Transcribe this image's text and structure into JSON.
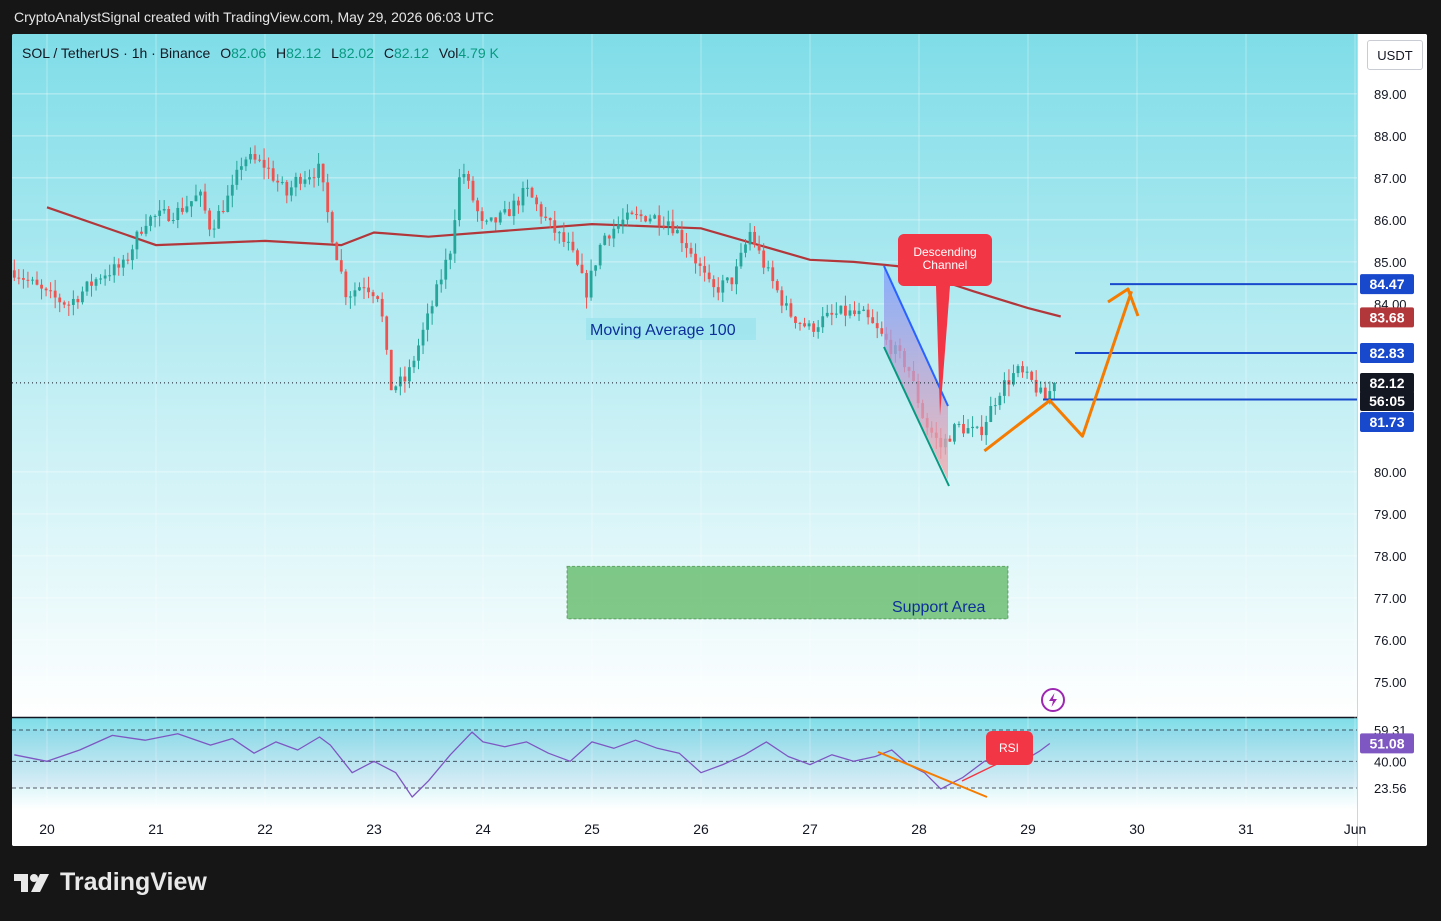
{
  "header": {
    "caption": "CryptoAnalystSignal created with TradingView.com, May 29, 2026 06:03 UTC"
  },
  "legend": {
    "symbol": "SOL / TetherUS · 1h · Binance",
    "open_label": "O",
    "open": "82.06",
    "high_label": "H",
    "high": "82.12",
    "low_label": "L",
    "low": "82.02",
    "close_label": "C",
    "close": "82.12",
    "vol_label": "Vol",
    "vol": "4.79 K"
  },
  "currency_button": "USDT",
  "brand": {
    "name": "TradingView",
    "logo_icon": "tradingview-logo-icon"
  },
  "colors": {
    "up": "#26a69a",
    "down": "#ef5350",
    "ma": "#b2373b",
    "channel": "#2962ff",
    "channel_lower": "#089981",
    "projection": "#f57c00",
    "support": "#4caf50",
    "callout": "#f23645",
    "rsi": "#7e57c2",
    "levels": "#1848cc"
  },
  "chart_data": [
    {
      "type": "candlestick",
      "title": "",
      "x_ticks": [
        "20",
        "21",
        "22",
        "23",
        "24",
        "25",
        "26",
        "27",
        "28",
        "29",
        "30",
        "31",
        "Jun"
      ],
      "y_ticks": [
        "75.00",
        "76.00",
        "77.00",
        "78.00",
        "79.00",
        "80.00",
        "84.00",
        "85.00",
        "86.00",
        "87.00",
        "88.00",
        "89.00"
      ],
      "ylim": [
        74.2,
        90.0
      ],
      "price_badges": [
        "84.47",
        "83.68",
        "82.83",
        "82.12",
        "56:05",
        "81.73"
      ],
      "current_price": 82.12,
      "moving_average_label": "Moving Average 100",
      "moving_average_100": [
        [
          0,
          86.3
        ],
        [
          1,
          85.4
        ],
        [
          2,
          85.5
        ],
        [
          2.7,
          85.4
        ],
        [
          3,
          85.7
        ],
        [
          3.5,
          85.6
        ],
        [
          4,
          85.7
        ],
        [
          5,
          85.9
        ],
        [
          6,
          85.8
        ],
        [
          7,
          85.05
        ],
        [
          7.4,
          85.0
        ],
        [
          7.8,
          84.9
        ],
        [
          8.5,
          84.3
        ],
        [
          9,
          83.9
        ],
        [
          9.3,
          83.7
        ]
      ],
      "close_path": [
        [
          -0.3,
          84.8
        ],
        [
          0,
          84.2
        ],
        [
          0.2,
          84.0
        ],
        [
          0.5,
          84.7
        ],
        [
          0.7,
          84.9
        ],
        [
          0.9,
          86.0
        ],
        [
          1.2,
          86.2
        ],
        [
          1.4,
          86.6
        ],
        [
          1.5,
          85.8
        ],
        [
          1.7,
          86.7
        ],
        [
          1.8,
          87.5
        ],
        [
          2.0,
          87.3
        ],
        [
          2.2,
          86.6
        ],
        [
          2.3,
          87.0
        ],
        [
          2.5,
          87.2
        ],
        [
          2.6,
          85.8
        ],
        [
          2.75,
          84.2
        ],
        [
          2.9,
          84.5
        ],
        [
          3.05,
          84.2
        ],
        [
          3.15,
          82.0
        ],
        [
          3.3,
          82.2
        ],
        [
          3.5,
          83.7
        ],
        [
          3.7,
          85.3
        ],
        [
          3.8,
          87.3
        ],
        [
          4.0,
          85.8
        ],
        [
          4.2,
          86.1
        ],
        [
          4.4,
          86.7
        ],
        [
          4.6,
          85.9
        ],
        [
          4.8,
          85.3
        ],
        [
          4.95,
          84.3
        ],
        [
          5.1,
          85.6
        ],
        [
          5.3,
          86.0
        ],
        [
          5.5,
          86.1
        ],
        [
          5.7,
          86.0
        ],
        [
          5.9,
          85.3
        ],
        [
          6.1,
          84.3
        ],
        [
          6.3,
          84.6
        ],
        [
          6.45,
          85.7
        ],
        [
          6.6,
          84.8
        ],
        [
          6.8,
          83.8
        ],
        [
          7.0,
          83.4
        ],
        [
          7.1,
          83.6
        ],
        [
          7.3,
          83.8
        ],
        [
          7.5,
          83.7
        ],
        [
          7.7,
          83.1
        ],
        [
          7.9,
          82.5
        ],
        [
          8.05,
          81.2
        ],
        [
          8.2,
          80.6
        ],
        [
          8.35,
          81.1
        ],
        [
          8.55,
          80.9
        ],
        [
          8.75,
          82.0
        ],
        [
          8.9,
          82.4
        ],
        [
          9.05,
          82.1
        ],
        [
          9.15,
          81.7
        ],
        [
          9.25,
          82.12
        ]
      ],
      "annotations": {
        "descending_channel": "Descending\nChannel",
        "support_area": "Support Area",
        "support_range": [
          76.5,
          77.75
        ],
        "level_lines": [
          84.47,
          82.83,
          81.73
        ],
        "projection_path": [
          [
            8.6,
            80.5
          ],
          [
            9.2,
            81.7
          ],
          [
            9.5,
            80.85
          ],
          [
            9.95,
            84.3
          ]
        ]
      }
    },
    {
      "type": "line",
      "title": "",
      "legend": "RSI",
      "levels": [
        59.31,
        40.0,
        23.56
      ],
      "badges": [
        "59.31",
        "51.08",
        "40.00",
        "23.56"
      ],
      "current_value": 51.08,
      "ylim": [
        10,
        68
      ],
      "values_path": [
        [
          -0.3,
          44
        ],
        [
          0,
          40
        ],
        [
          0.3,
          47
        ],
        [
          0.6,
          56
        ],
        [
          0.9,
          53
        ],
        [
          1.2,
          57
        ],
        [
          1.5,
          50
        ],
        [
          1.7,
          54
        ],
        [
          1.9,
          45
        ],
        [
          2.1,
          52
        ],
        [
          2.3,
          47
        ],
        [
          2.5,
          55
        ],
        [
          2.6,
          50
        ],
        [
          2.8,
          33
        ],
        [
          3.0,
          40
        ],
        [
          3.2,
          33
        ],
        [
          3.35,
          18
        ],
        [
          3.5,
          28
        ],
        [
          3.7,
          44
        ],
        [
          3.9,
          58
        ],
        [
          4.0,
          52
        ],
        [
          4.2,
          49
        ],
        [
          4.4,
          52
        ],
        [
          4.6,
          45
        ],
        [
          4.8,
          40
        ],
        [
          5.0,
          52
        ],
        [
          5.2,
          48
        ],
        [
          5.4,
          53
        ],
        [
          5.6,
          48
        ],
        [
          5.8,
          45
        ],
        [
          6.0,
          33
        ],
        [
          6.2,
          38
        ],
        [
          6.4,
          44
        ],
        [
          6.6,
          52
        ],
        [
          6.8,
          43
        ],
        [
          7.0,
          38
        ],
        [
          7.2,
          44
        ],
        [
          7.4,
          40
        ],
        [
          7.6,
          43
        ],
        [
          7.75,
          47
        ],
        [
          7.9,
          38
        ],
        [
          8.05,
          33
        ],
        [
          8.2,
          23
        ],
        [
          8.4,
          30
        ],
        [
          8.6,
          40
        ],
        [
          8.8,
          45
        ],
        [
          9.0,
          42
        ],
        [
          9.1,
          46
        ],
        [
          9.2,
          51
        ]
      ]
    }
  ]
}
